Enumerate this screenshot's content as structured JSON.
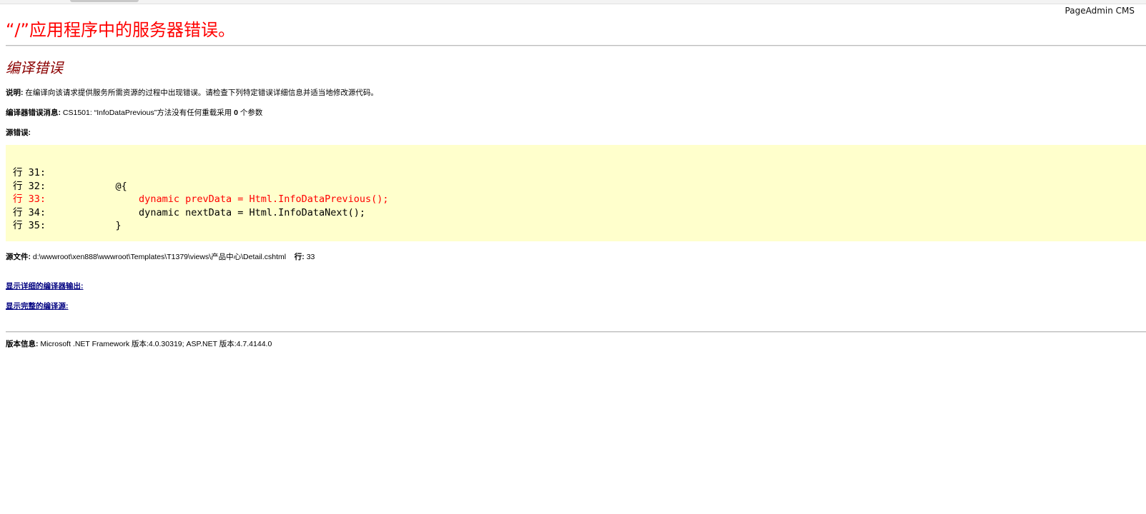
{
  "brand": "PageAdmin CMS",
  "title": "“/”应用程序中的服务器错误。",
  "subtitle": "编译错误",
  "description": {
    "label": "说明:",
    "text": " 在编译向该请求提供服务所需资源的过程中出现错误。请检查下列特定错误详细信息并适当地修改源代码。"
  },
  "compiler_message": {
    "label": "编译器错误消息:",
    "text_prefix": " CS1501: “InfoDataPrevious”方法没有任何重载采用 ",
    "bold_number": "0",
    "text_suffix": " 个参数"
  },
  "source_error": {
    "label": "源错误:",
    "lines": [
      {
        "prefix": "行 31:",
        "code": ""
      },
      {
        "prefix": "行 32:",
        "code": "            @{"
      },
      {
        "prefix": "行 33:",
        "code": "                dynamic prevData = Html.InfoDataPrevious();"
      },
      {
        "prefix": "行 34:",
        "code": "                dynamic nextData = Html.InfoDataNext();"
      },
      {
        "prefix": "行 35:",
        "code": "            }"
      }
    ]
  },
  "source_file": {
    "label": "源文件:",
    "path": " d:\\wwwroot\\xen888\\wwwroot\\Templates\\T1379\\views\\产品中心\\Detail.cshtml",
    "line_label": "行:",
    "line_value": " 33"
  },
  "links": {
    "compiler_output": "显示详细的编译器输出:",
    "compiler_source": "显示完整的编译源:"
  },
  "version": {
    "label": "版本信息:",
    "text": " Microsoft .NET Framework 版本:4.0.30319; ASP.NET 版本:4.7.4144.0"
  },
  "colors": {
    "title": "#ff0000",
    "subtitle": "#8b0000",
    "code_background": "#ffffcc",
    "link": "#000080"
  }
}
